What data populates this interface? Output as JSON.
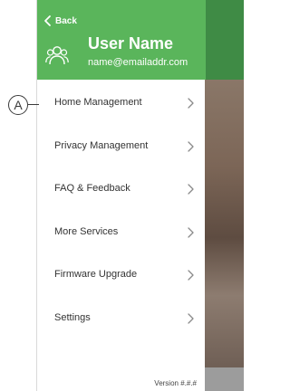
{
  "header": {
    "back_label": "Back",
    "user_name": "User Name",
    "user_email": "name@emailaddr.com"
  },
  "menu": {
    "items": [
      {
        "label": "Home Management",
        "icon": "chevron-right-icon"
      },
      {
        "label": "Privacy Management",
        "icon": "chevron-right-icon"
      },
      {
        "label": "FAQ & Feedback",
        "icon": "chevron-right-icon"
      },
      {
        "label": "More Services",
        "icon": "chevron-right-icon"
      },
      {
        "label": "Firmware Upgrade",
        "icon": "chevron-right-icon"
      },
      {
        "label": "Settings",
        "icon": "chevron-right-icon"
      }
    ]
  },
  "footer": {
    "version": "Version #.#.#"
  },
  "callout": {
    "label": "A"
  },
  "colors": {
    "header_green": "#5ab55b",
    "background_header_green": "#3f8b45",
    "text": "#333333",
    "chevron": "#8a8a8a"
  }
}
